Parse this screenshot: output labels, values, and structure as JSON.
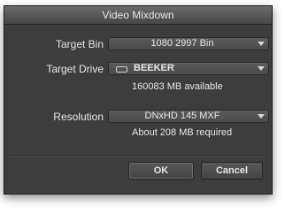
{
  "window": {
    "title": "Video Mixdown"
  },
  "form": {
    "target_bin": {
      "label": "Target Bin",
      "value": "1080 2997 Bin"
    },
    "target_drive": {
      "label": "Target Drive",
      "value": "BEEKER",
      "info": "160083 MB available"
    },
    "resolution": {
      "label": "Resolution",
      "value": "DNxHD 145  MXF",
      "info": "About 208 MB required"
    }
  },
  "buttons": {
    "ok_label": "OK",
    "cancel_label": "Cancel"
  },
  "icons": {
    "dropdown_arrow": "chevron-down-icon",
    "drive": "drive-icon"
  },
  "colors": {
    "dialog_bg": "#3d3d3d",
    "titlebar": "#575757",
    "text": "#e8e8e8"
  }
}
